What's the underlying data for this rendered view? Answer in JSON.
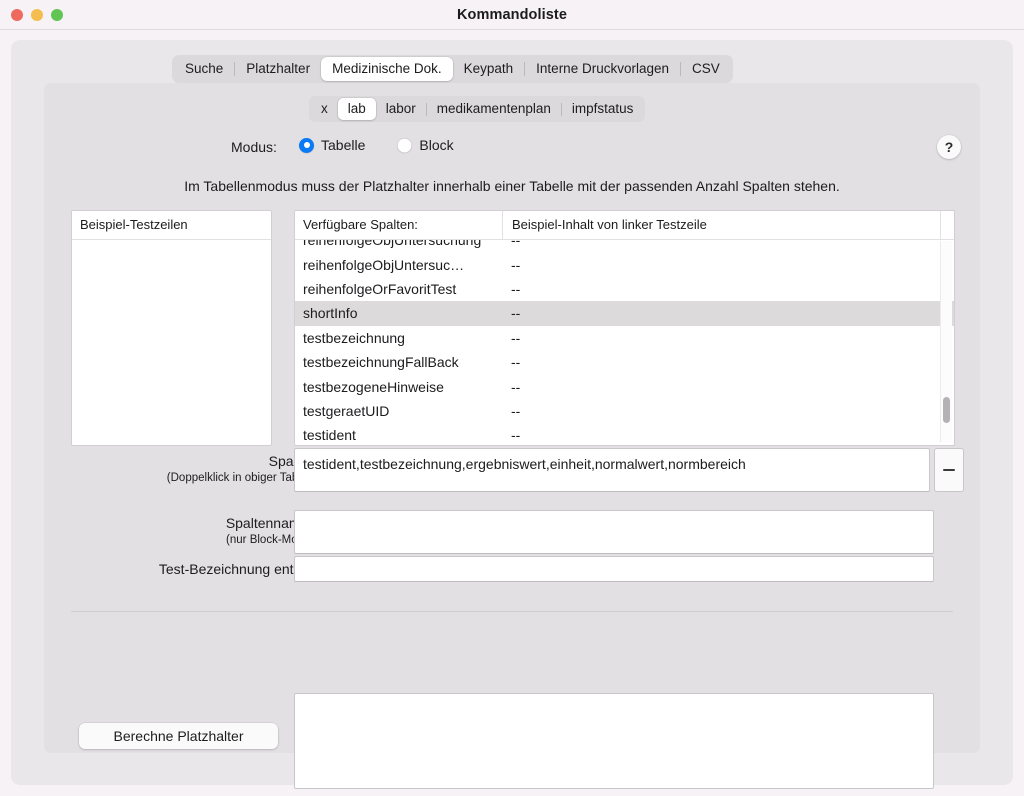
{
  "window": {
    "title": "Kommandoliste",
    "traffic_lights": [
      "close-button",
      "minimize-button",
      "zoom-button"
    ]
  },
  "main_tabs": [
    {
      "label": "Suche",
      "active": false
    },
    {
      "label": "Platzhalter",
      "active": false
    },
    {
      "label": "Medizinische Dok.",
      "active": true
    },
    {
      "label": "Keypath",
      "active": false
    },
    {
      "label": "Interne Druckvorlagen",
      "active": false
    },
    {
      "label": "CSV",
      "active": false
    }
  ],
  "sub_tabs": [
    {
      "label": "x",
      "active": false
    },
    {
      "label": "lab",
      "active": true
    },
    {
      "label": "labor",
      "active": false
    },
    {
      "label": "medikamentenplan",
      "active": false
    },
    {
      "label": "impfstatus",
      "active": false
    }
  ],
  "modus": {
    "label": "Modus:",
    "options": [
      {
        "label": "Tabelle",
        "selected": true
      },
      {
        "label": "Block",
        "selected": false
      }
    ]
  },
  "help_button": {
    "glyph": "?"
  },
  "hint": "Im Tabellenmodus muss der Platzhalter innerhalb einer Tabelle mit der passenden Anzahl Spalten stehen.",
  "left_table": {
    "header": "Beispiel-Testzeilen",
    "rows": []
  },
  "right_table": {
    "headers": [
      "Verfügbare Spalten:",
      "Beispiel-Inhalt von linker Testzeile"
    ],
    "rows": [
      {
        "name": "reihenfolgeObjUntersuchung",
        "value": "--",
        "selected": false,
        "clipped": true
      },
      {
        "name": "reihenfolgeObjUntersuc…",
        "value": "--",
        "selected": false
      },
      {
        "name": "reihenfolgeOrFavoritTest",
        "value": "--",
        "selected": false
      },
      {
        "name": "shortInfo",
        "value": "--",
        "selected": true
      },
      {
        "name": "testbezeichnung",
        "value": "--",
        "selected": false
      },
      {
        "name": "testbezeichnungFallBack",
        "value": "--",
        "selected": false
      },
      {
        "name": "testbezogeneHinweise",
        "value": "--",
        "selected": false
      },
      {
        "name": "testgeraetUID",
        "value": "--",
        "selected": false
      },
      {
        "name": "testident",
        "value": "--",
        "selected": false
      }
    ]
  },
  "fields": {
    "spalten": {
      "label": "Spalten:",
      "sublabel": "(Doppelklick in obiger Tabelle)",
      "value": "testident,testbezeichnung,ergebniswert,einheit,normalwert,normbereich",
      "placeholder": ""
    },
    "spaltennamen": {
      "label": "Spaltennamen:",
      "sublabel": "(nur Block-Modus)",
      "value": "",
      "placeholder": ""
    },
    "test_bezeichnung": {
      "label": "Test-Bezeichnung enthält:",
      "value": "",
      "placeholder": ""
    }
  },
  "stepper": {
    "minus_label": "−"
  },
  "calc_button": {
    "label": "Berechne Platzhalter"
  },
  "output": {
    "value": ""
  }
}
